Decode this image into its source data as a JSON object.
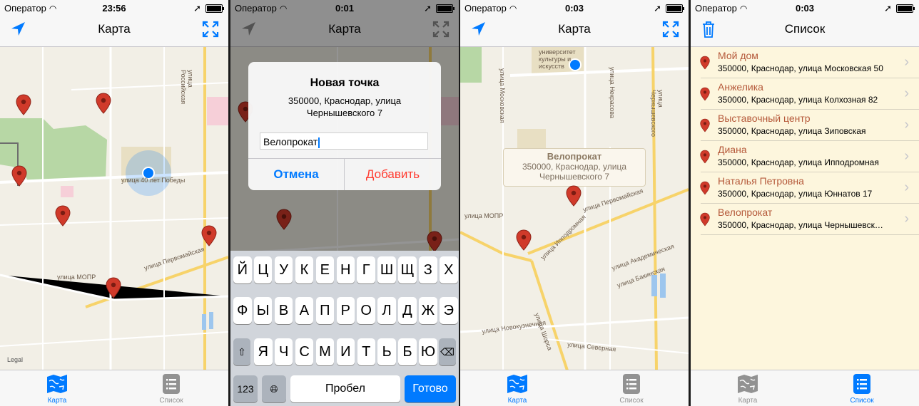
{
  "status_bar": {
    "carrier": "Оператор",
    "times": [
      "23:56",
      "0:01",
      "0:03",
      "0:03"
    ]
  },
  "screen1": {
    "title": "Карта",
    "legal": "Legal",
    "street_labels": [
      "улица Российская",
      "улица Первомайская",
      "улица МОПР",
      "улица 40 лет Победы"
    ]
  },
  "screen2": {
    "title": "Карта",
    "alert": {
      "title": "Новая точка",
      "message": "350000, Краснодар, улица Чернышевского 7",
      "input_value": "Велопрокат",
      "cancel_label": "Отмена",
      "add_label": "Добавить"
    },
    "keyboard": {
      "row1": [
        "Й",
        "Ц",
        "У",
        "К",
        "Е",
        "Н",
        "Г",
        "Ш",
        "Щ",
        "З",
        "Х"
      ],
      "row2": [
        "Ф",
        "Ы",
        "В",
        "А",
        "П",
        "Р",
        "О",
        "Л",
        "Д",
        "Ж",
        "Э"
      ],
      "row3": [
        "Я",
        "Ч",
        "С",
        "М",
        "И",
        "Т",
        "Ь",
        "Б",
        "Ю"
      ],
      "numbers_label": "123",
      "space_label": "Пробел",
      "done_label": "Готово"
    }
  },
  "screen3": {
    "title": "Карта",
    "callout": {
      "title": "Велопрокат",
      "subtitle": "350000, Краснодар, улица Чернышевского 7"
    },
    "street_labels": [
      "университет культуры и искусств",
      "улица Московская",
      "улица Некрасова",
      "улица Чернышевского",
      "улица Первомайская",
      "улица МОПР",
      "улица Ипподромная",
      "улица Академическая",
      "улица Бакинская",
      "улица Шорса",
      "улица Новокузнечная",
      "улица Северная"
    ]
  },
  "screen4": {
    "title": "Список",
    "items": [
      {
        "title": "Мой дом",
        "subtitle": "350000, Краснодар, улица Московская 50"
      },
      {
        "title": "Анжелика",
        "subtitle": "350000, Краснодар, улица Колхозная 82"
      },
      {
        "title": "Выставочный центр",
        "subtitle": "350000, Краснодар, улица Зиповская"
      },
      {
        "title": "Диана",
        "subtitle": "350000, Краснодар, улица Ипподромная"
      },
      {
        "title": "Наталья Петровна",
        "subtitle": "350000, Краснодар, улица Юннатов 17"
      },
      {
        "title": "Велопрокат",
        "subtitle": "350000, Краснодар, улица Чернышевск…"
      }
    ]
  },
  "tabbar": {
    "map_label": "Карта",
    "list_label": "Список"
  },
  "colors": {
    "accent": "#007aff",
    "pin": "#d03a2a",
    "destructive": "#ff3b30",
    "list_title": "#b5593a",
    "map_bg": "#f2efe6"
  },
  "icons": {
    "nav_left": "location-arrow-icon",
    "nav_right": "expand-icon",
    "nav_left_list": "trash-icon",
    "tab_map": "map-icon",
    "tab_list": "list-icon",
    "pin": "map-pin-icon"
  }
}
